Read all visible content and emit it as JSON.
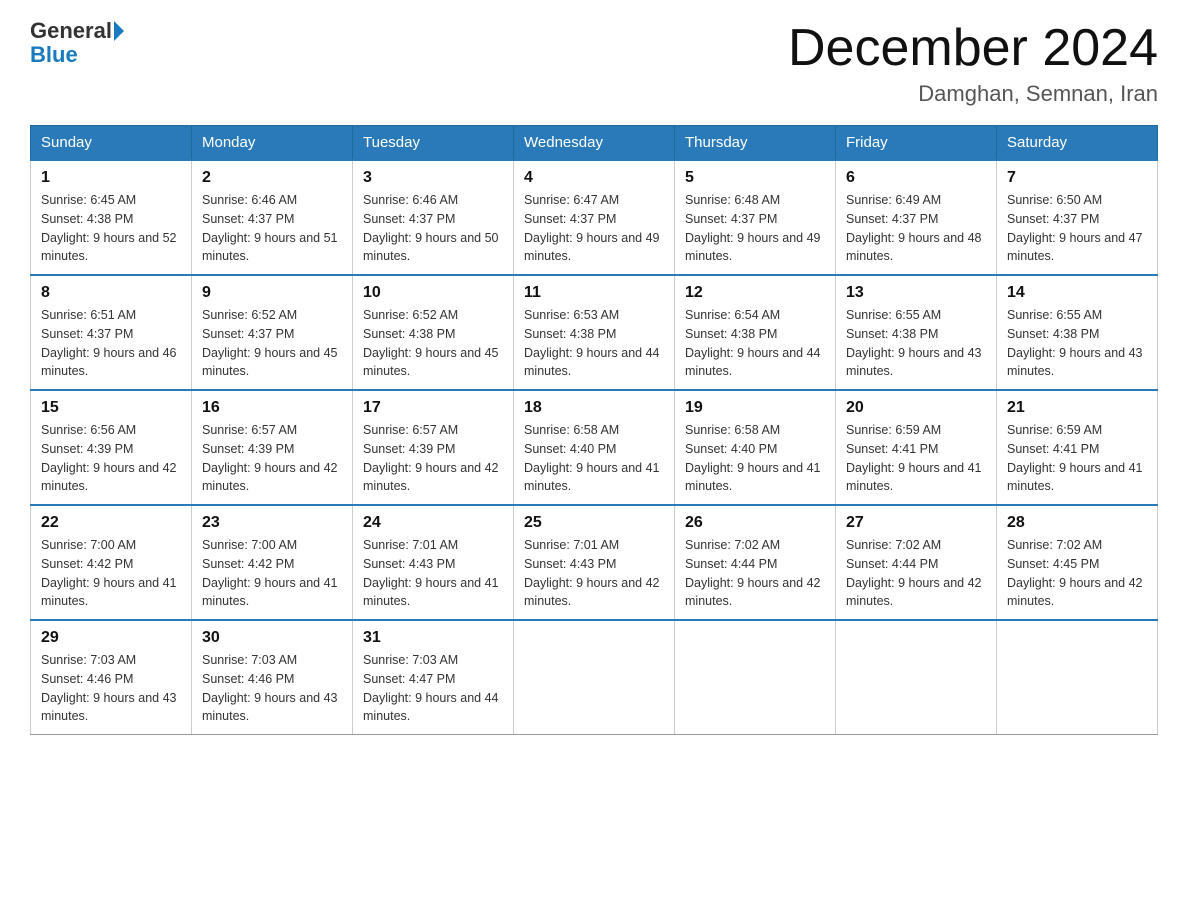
{
  "header": {
    "logo_text_general": "General",
    "logo_text_blue": "Blue",
    "month_title": "December 2024",
    "location": "Damghan, Semnan, Iran"
  },
  "weekdays": [
    "Sunday",
    "Monday",
    "Tuesday",
    "Wednesday",
    "Thursday",
    "Friday",
    "Saturday"
  ],
  "weeks": [
    [
      {
        "day": "1",
        "sunrise": "6:45 AM",
        "sunset": "4:38 PM",
        "daylight": "9 hours and 52 minutes."
      },
      {
        "day": "2",
        "sunrise": "6:46 AM",
        "sunset": "4:37 PM",
        "daylight": "9 hours and 51 minutes."
      },
      {
        "day": "3",
        "sunrise": "6:46 AM",
        "sunset": "4:37 PM",
        "daylight": "9 hours and 50 minutes."
      },
      {
        "day": "4",
        "sunrise": "6:47 AM",
        "sunset": "4:37 PM",
        "daylight": "9 hours and 49 minutes."
      },
      {
        "day": "5",
        "sunrise": "6:48 AM",
        "sunset": "4:37 PM",
        "daylight": "9 hours and 49 minutes."
      },
      {
        "day": "6",
        "sunrise": "6:49 AM",
        "sunset": "4:37 PM",
        "daylight": "9 hours and 48 minutes."
      },
      {
        "day": "7",
        "sunrise": "6:50 AM",
        "sunset": "4:37 PM",
        "daylight": "9 hours and 47 minutes."
      }
    ],
    [
      {
        "day": "8",
        "sunrise": "6:51 AM",
        "sunset": "4:37 PM",
        "daylight": "9 hours and 46 minutes."
      },
      {
        "day": "9",
        "sunrise": "6:52 AM",
        "sunset": "4:37 PM",
        "daylight": "9 hours and 45 minutes."
      },
      {
        "day": "10",
        "sunrise": "6:52 AM",
        "sunset": "4:38 PM",
        "daylight": "9 hours and 45 minutes."
      },
      {
        "day": "11",
        "sunrise": "6:53 AM",
        "sunset": "4:38 PM",
        "daylight": "9 hours and 44 minutes."
      },
      {
        "day": "12",
        "sunrise": "6:54 AM",
        "sunset": "4:38 PM",
        "daylight": "9 hours and 44 minutes."
      },
      {
        "day": "13",
        "sunrise": "6:55 AM",
        "sunset": "4:38 PM",
        "daylight": "9 hours and 43 minutes."
      },
      {
        "day": "14",
        "sunrise": "6:55 AM",
        "sunset": "4:38 PM",
        "daylight": "9 hours and 43 minutes."
      }
    ],
    [
      {
        "day": "15",
        "sunrise": "6:56 AM",
        "sunset": "4:39 PM",
        "daylight": "9 hours and 42 minutes."
      },
      {
        "day": "16",
        "sunrise": "6:57 AM",
        "sunset": "4:39 PM",
        "daylight": "9 hours and 42 minutes."
      },
      {
        "day": "17",
        "sunrise": "6:57 AM",
        "sunset": "4:39 PM",
        "daylight": "9 hours and 42 minutes."
      },
      {
        "day": "18",
        "sunrise": "6:58 AM",
        "sunset": "4:40 PM",
        "daylight": "9 hours and 41 minutes."
      },
      {
        "day": "19",
        "sunrise": "6:58 AM",
        "sunset": "4:40 PM",
        "daylight": "9 hours and 41 minutes."
      },
      {
        "day": "20",
        "sunrise": "6:59 AM",
        "sunset": "4:41 PM",
        "daylight": "9 hours and 41 minutes."
      },
      {
        "day": "21",
        "sunrise": "6:59 AM",
        "sunset": "4:41 PM",
        "daylight": "9 hours and 41 minutes."
      }
    ],
    [
      {
        "day": "22",
        "sunrise": "7:00 AM",
        "sunset": "4:42 PM",
        "daylight": "9 hours and 41 minutes."
      },
      {
        "day": "23",
        "sunrise": "7:00 AM",
        "sunset": "4:42 PM",
        "daylight": "9 hours and 41 minutes."
      },
      {
        "day": "24",
        "sunrise": "7:01 AM",
        "sunset": "4:43 PM",
        "daylight": "9 hours and 41 minutes."
      },
      {
        "day": "25",
        "sunrise": "7:01 AM",
        "sunset": "4:43 PM",
        "daylight": "9 hours and 42 minutes."
      },
      {
        "day": "26",
        "sunrise": "7:02 AM",
        "sunset": "4:44 PM",
        "daylight": "9 hours and 42 minutes."
      },
      {
        "day": "27",
        "sunrise": "7:02 AM",
        "sunset": "4:44 PM",
        "daylight": "9 hours and 42 minutes."
      },
      {
        "day": "28",
        "sunrise": "7:02 AM",
        "sunset": "4:45 PM",
        "daylight": "9 hours and 42 minutes."
      }
    ],
    [
      {
        "day": "29",
        "sunrise": "7:03 AM",
        "sunset": "4:46 PM",
        "daylight": "9 hours and 43 minutes."
      },
      {
        "day": "30",
        "sunrise": "7:03 AM",
        "sunset": "4:46 PM",
        "daylight": "9 hours and 43 minutes."
      },
      {
        "day": "31",
        "sunrise": "7:03 AM",
        "sunset": "4:47 PM",
        "daylight": "9 hours and 44 minutes."
      },
      null,
      null,
      null,
      null
    ]
  ],
  "labels": {
    "sunrise_prefix": "Sunrise: ",
    "sunset_prefix": "Sunset: ",
    "daylight_prefix": "Daylight: "
  }
}
